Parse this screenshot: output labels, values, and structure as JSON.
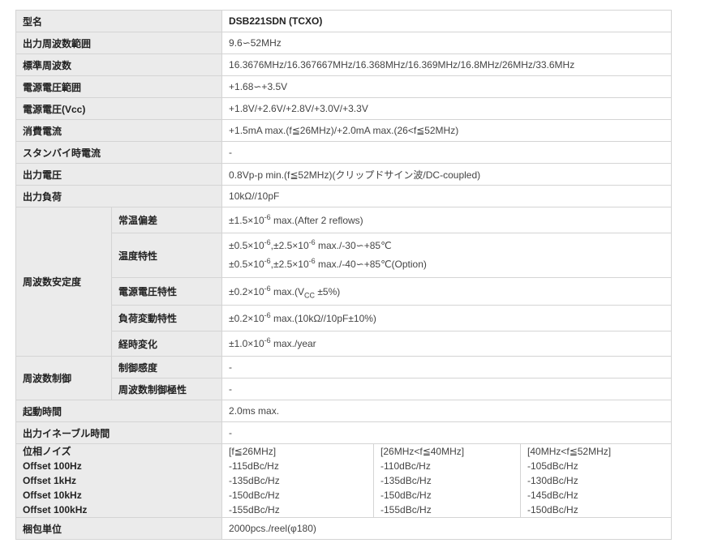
{
  "rows": {
    "model": {
      "label": "型名",
      "value": "DSB221SDN (TCXO)"
    },
    "freq_range": {
      "label": "出力周波数範囲",
      "value": "9.6∽52MHz"
    },
    "std_freq": {
      "label": "標準周波数",
      "value": "16.3676MHz/16.367667MHz/16.368MHz/16.369MHz/16.8MHz/26MHz/33.6MHz"
    },
    "supply_range": {
      "label": "電源電圧範囲",
      "value": "+1.68∽+3.5V"
    },
    "supply_vcc": {
      "label": "電源電圧(Vcc)",
      "value": "+1.8V/+2.6V/+2.8V/+3.0V/+3.3V"
    },
    "current": {
      "label": "消費電流",
      "value": "+1.5mA max.(f≦26MHz)/+2.0mA max.(26<f≦52MHz)"
    },
    "standby": {
      "label": "スタンバイ時電流",
      "value": "-"
    },
    "out_voltage": {
      "label": "出力電圧",
      "value": "0.8Vp-p min.(f≦52MHz)(クリップドサイン波/DC-coupled)"
    },
    "load": {
      "label": "出力負荷",
      "value": "10kΩ//10pF"
    },
    "stability": {
      "label": "周波数安定度",
      "room_temp": {
        "label": "常温偏差",
        "pre": "±1.5×10",
        "exp": "-6",
        "post": " max.(After 2 reflows)"
      },
      "temp": {
        "label": "温度特性",
        "l1_a": "±0.5×10",
        "l1_a_exp": "-6",
        "l1_b": ",±2.5×10",
        "l1_b_exp": "-6",
        "l1_c": " max./-30∽+85℃",
        "l2_a": "±0.5×10",
        "l2_a_exp": "-6",
        "l2_b": ",±2.5×10",
        "l2_b_exp": "-6",
        "l2_c": " max./-40∽+85℃(Option)"
      },
      "supply": {
        "label": "電源電圧特性",
        "pre": "±0.2×10",
        "exp": "-6",
        "mid": " max.(V",
        "sub": "CC",
        "post": " ±5%)"
      },
      "load": {
        "label": "負荷変動特性",
        "pre": "±0.2×10",
        "exp": "-6",
        "post": " max.(10kΩ//10pF±10%)"
      },
      "aging": {
        "label": "経時変化",
        "pre": "±1.0×10",
        "exp": "-6",
        "post": " max./year"
      }
    },
    "freq_control": {
      "label": "周波数制御",
      "sensitivity": {
        "label": "制御感度",
        "value": "-"
      },
      "polarity": {
        "label": "周波数制御極性",
        "value": "-"
      }
    },
    "startup": {
      "label": "起動時間",
      "value": "2.0ms max."
    },
    "enable": {
      "label": "出力イネーブル時間",
      "value": "-"
    },
    "phase_noise": {
      "labels": [
        "位相ノイズ",
        "Offset 100Hz",
        "Offset 1kHz",
        "Offset 10kHz",
        "Offset 100kHz"
      ],
      "col1": [
        "[f≦26MHz]",
        "-115dBc/Hz",
        "-135dBc/Hz",
        "-150dBc/Hz",
        "-155dBc/Hz"
      ],
      "col2": [
        "[26MHz<f≦40MHz]",
        "-110dBc/Hz",
        "-135dBc/Hz",
        "-150dBc/Hz",
        "-155dBc/Hz"
      ],
      "col3": [
        "[40MHz<f≦52MHz]",
        "-105dBc/Hz",
        "-130dBc/Hz",
        "-145dBc/Hz",
        "-150dBc/Hz"
      ]
    },
    "packing": {
      "label": "梱包単位",
      "value": "2000pcs./reel(φ180)"
    }
  }
}
